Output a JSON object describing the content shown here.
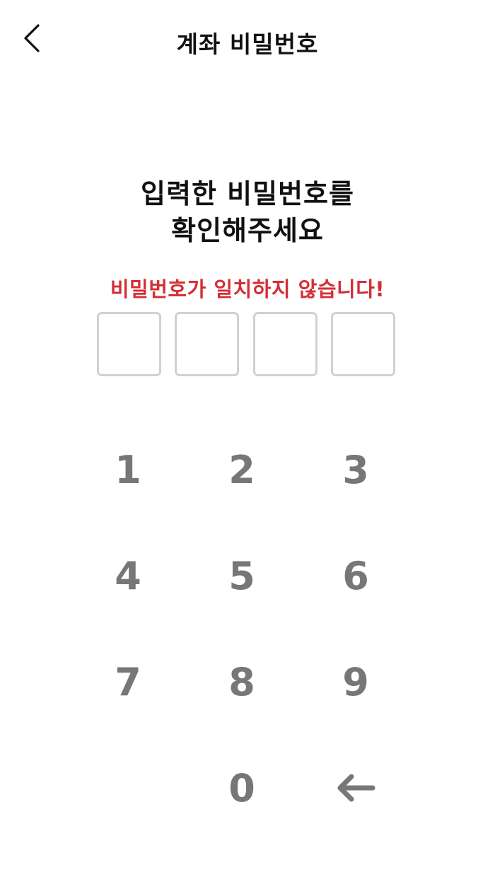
{
  "header": {
    "title": "계좌 비밀번호",
    "back_icon": "chevron-left-icon"
  },
  "prompt": {
    "line1": "입력한 비밀번호를",
    "line2": "확인해주세요"
  },
  "error": {
    "message": "비밀번호가 일치하지 않습니다!",
    "color": "#d32f36"
  },
  "pin": {
    "length": 4,
    "entered": 0
  },
  "keypad": {
    "keys": [
      "1",
      "2",
      "3",
      "4",
      "5",
      "6",
      "7",
      "8",
      "9",
      "0"
    ],
    "backspace_icon": "arrow-left-icon"
  },
  "colors": {
    "key_text": "#777777",
    "box_border": "#cfd1d9",
    "title_text": "#111111"
  }
}
